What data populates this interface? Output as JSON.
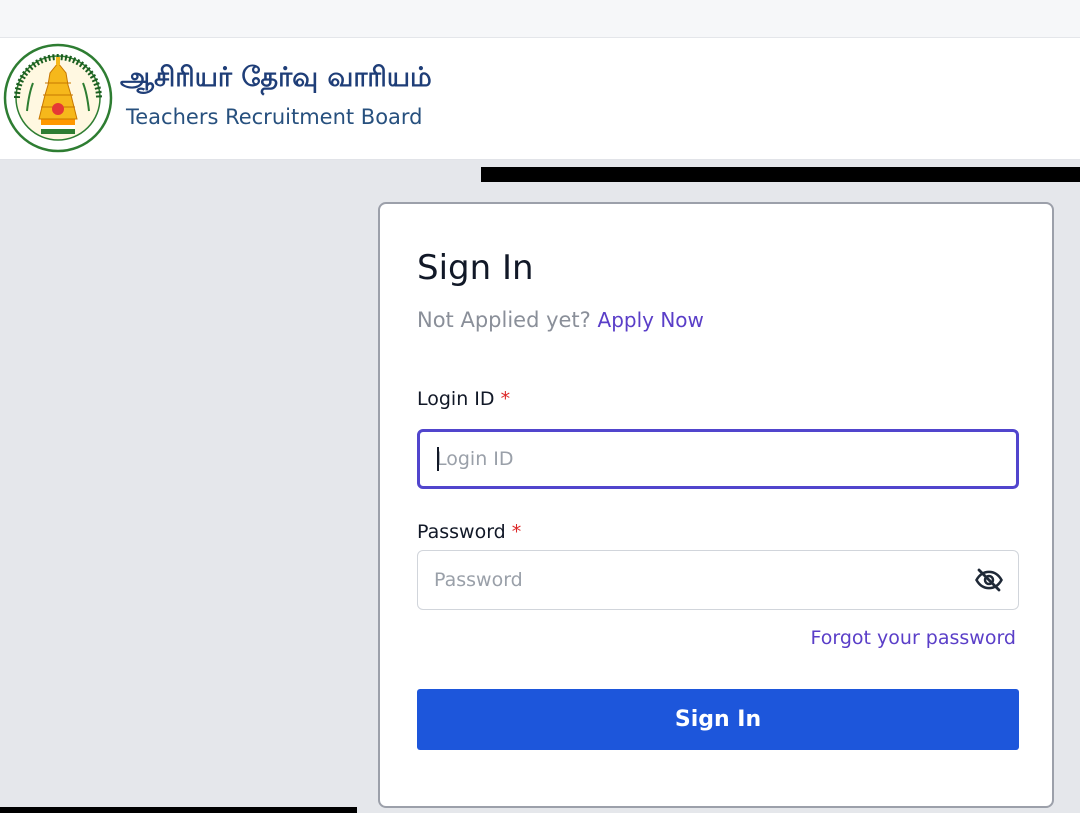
{
  "header": {
    "brand_tamil": "ஆசிரியர் தேர்வு வாரியம்",
    "brand_english": "Teachers Recruitment Board"
  },
  "signin": {
    "title": "Sign In",
    "not_applied_text": "Not Applied yet?",
    "apply_link": "Apply Now",
    "login_label": "Login ID",
    "login_placeholder": "Login ID",
    "login_value": "",
    "password_label": "Password",
    "password_placeholder": "Password",
    "password_value": "",
    "required_marker": "*",
    "forgot_link": "Forgot your password",
    "submit_label": "Sign In"
  },
  "icons": {
    "logo": "tamil-nadu-emblem-icon",
    "toggle_password": "eye-off-icon"
  },
  "colors": {
    "primary_button": "#1d56db",
    "link": "#5a3ec8",
    "focus_border": "#5145cd",
    "required": "#dc2626",
    "brand_text": "#1f3e78"
  }
}
